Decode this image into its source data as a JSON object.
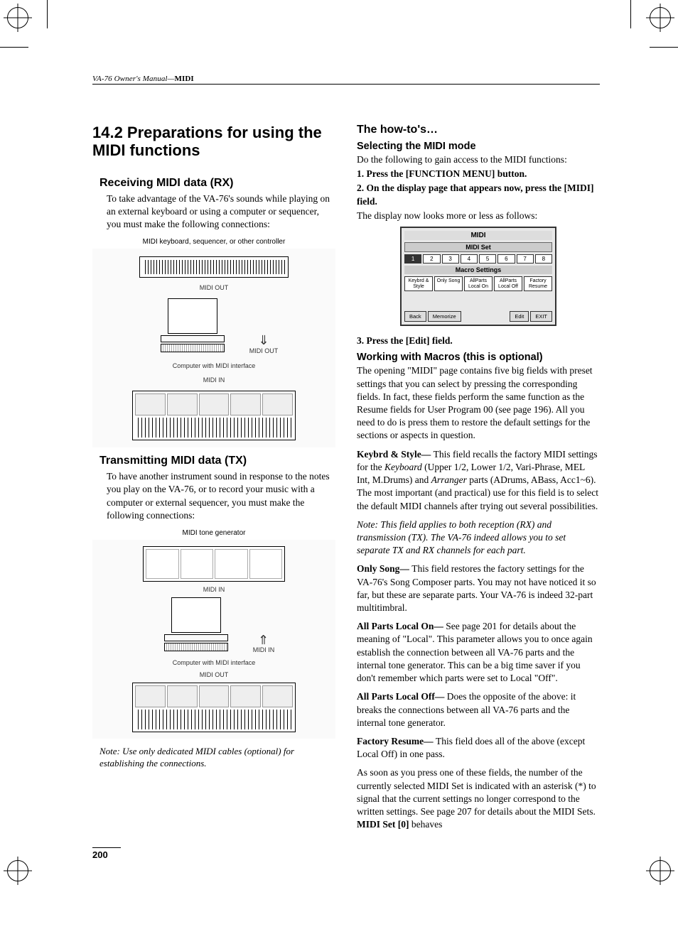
{
  "header": {
    "product": "VA-76 Owner's Manual",
    "section": "MIDI"
  },
  "left": {
    "h1": "14.2 Preparations for using the MIDI functions",
    "rx_heading": "Receiving MIDI data (RX)",
    "rx_body": "To take advantage of the VA-76's sounds while playing on an external keyboard or using a computer or sequencer, you must make the following connections:",
    "rx_fig_top": "MIDI keyboard, sequencer, or other controller",
    "rx_fig_midiout": "MIDI OUT",
    "rx_fig_comp": "Computer with MIDI interface",
    "rx_fig_midiin": "MIDI IN",
    "tx_heading": "Transmitting MIDI data (TX)",
    "tx_body": "To have another instrument sound in response to the notes you play on the VA-76, or to record your music with a computer or external sequencer, you must make the following connections:",
    "tx_fig_top": "MIDI tone generator",
    "tx_fig_midiin": "MIDI IN",
    "tx_fig_comp": "Computer with MIDI interface",
    "tx_fig_midiout": "MIDI OUT",
    "tx_note": "Note: Use only dedicated MIDI cables (optional) for establishing the connections."
  },
  "right": {
    "howto_heading": "The how-to's…",
    "sel_heading": "Selecting the MIDI mode",
    "sel_intro": "Do the following to gain access to the MIDI functions:",
    "step1": "1. Press the [FUNCTION MENU] button.",
    "step2": "2. On the display page that appears now, press the [MIDI] field.",
    "step2_after": "The display now looks more or less as follows:",
    "step3": "3. Press the [Edit] field.",
    "screen": {
      "title": "MIDI",
      "set": "MIDI Set",
      "nums": [
        "1",
        "2",
        "3",
        "4",
        "5",
        "6",
        "7",
        "8"
      ],
      "macro_label": "Macro Settings",
      "buttons": [
        "Keybrd & Style",
        "Only Song",
        "AllParts Local On",
        "AllParts Local Off",
        "Factory Resume"
      ],
      "bottom": [
        "Back",
        "Memorize",
        "Edit",
        "EXIT"
      ]
    },
    "macros_heading": "Working with Macros (this is optional)",
    "macros_intro": "The opening \"MIDI\" page contains five big fields with preset settings that you can select by pressing the corresponding fields. In fact, these fields perform the same function as the Resume fields for User Program 00 (see page 196). All you need to do is press them to restore the default settings for the sections or aspects in question.",
    "m1_lead": "Keybrd & Style— ",
    "m1_body_a": "This field recalls the factory MIDI settings for the ",
    "m1_kbd": "Keyboard",
    "m1_body_b": " (Upper 1/2, Lower 1/2, Vari-Phrase, MEL Int, M.Drums) and ",
    "m1_arr": "Arranger",
    "m1_body_c": " parts (ADrums, ABass, Acc1~6). The most important (and practical) use for this field is to select the default MIDI channels after trying out several possibilities.",
    "m1_note": "Note: This field applies to both reception (RX) and transmission (TX). The VA-76 indeed allows you to set separate TX and RX channels for each part.",
    "m2_lead": "Only Song— ",
    "m2_body": "This field restores the factory settings for the VA-76's Song Composer parts. You may not have noticed it so far, but these are separate parts. Your VA-76 is indeed 32-part multitimbral.",
    "m3_lead": "All Parts Local On— ",
    "m3_body": "See page 201 for details about the meaning of \"Local\". This parameter allows you to once again establish the connection between all VA-76 parts and the internal tone generator. This can be a big time saver if you don't remember which parts were set to Local \"Off\".",
    "m4_lead": "All Parts Local Off— ",
    "m4_body": "Does the opposite of the above: it breaks the connections between all VA-76 parts and the internal tone generator.",
    "m5_lead": "Factory Resume— ",
    "m5_body": "This field does all of the above (except Local Off) in one pass.",
    "closing_a": "As soon as you press one of these fields, the number of the currently selected MIDI Set is indicated with an asterisk (*) to signal that the current settings no longer correspond to the written settings. See page 207 for details about the MIDI Sets. ",
    "closing_b_lead": "MIDI Set [0]",
    "closing_b_tail": " behaves"
  },
  "page_number": "200"
}
